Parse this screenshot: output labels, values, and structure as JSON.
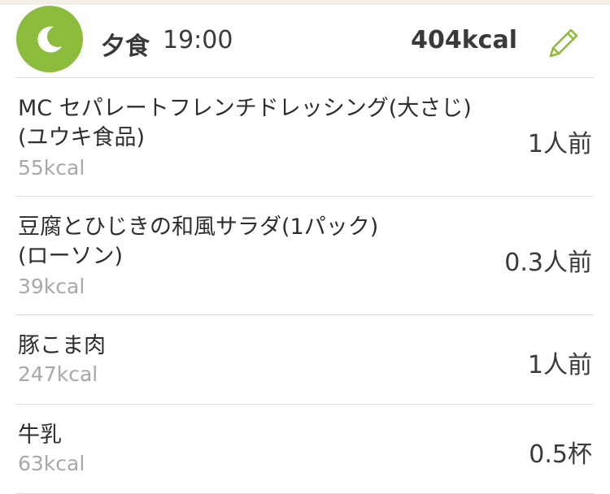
{
  "meal": {
    "icon": "crescent-moon-icon",
    "title": "夕食",
    "time": "19:00",
    "total_kcal": "404kcal",
    "edit_icon": "pencil-icon",
    "accent_color": "#8cbc3c"
  },
  "items": [
    {
      "name_line1": "MC セパレートフレンチドレッシング(大さじ)",
      "name_line2": "(ユウキ食品)",
      "kcal": "55kcal",
      "quantity": "1人前"
    },
    {
      "name_line1": "豆腐とひじきの和風サラダ(1パック)",
      "name_line2": "(ローソン)",
      "kcal": "39kcal",
      "quantity": "0.3人前"
    },
    {
      "name_line1": "豚こま肉",
      "kcal": "247kcal",
      "quantity": "1人前"
    },
    {
      "name_line1": "牛乳",
      "kcal": "63kcal",
      "quantity": "0.5杯"
    }
  ]
}
